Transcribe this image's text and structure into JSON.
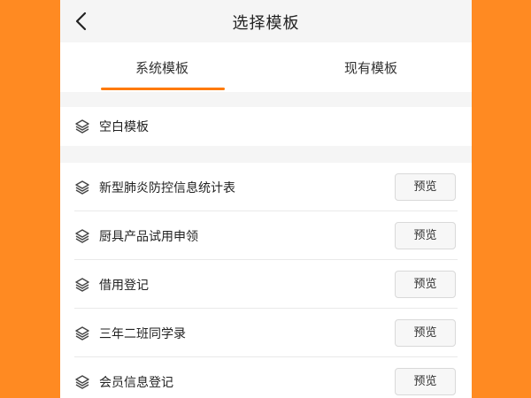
{
  "header": {
    "title": "选择模板"
  },
  "tabs": [
    {
      "label": "系统模板",
      "active": true
    },
    {
      "label": "现有模板",
      "active": false
    }
  ],
  "blank_template": {
    "label": "空白模板"
  },
  "templates": [
    {
      "label": "新型肺炎防控信息统计表",
      "action": "预览"
    },
    {
      "label": "厨具产品试用申领",
      "action": "预览"
    },
    {
      "label": "借用登记",
      "action": "预览"
    },
    {
      "label": "三年二班同学录",
      "action": "预览"
    },
    {
      "label": "会员信息登记",
      "action": "预览"
    }
  ],
  "colors": {
    "background_accent": "#ff8a22",
    "tab_underline": "#ff7a00"
  },
  "icons": {
    "back": "chevron-left-icon",
    "template": "layers-icon"
  }
}
